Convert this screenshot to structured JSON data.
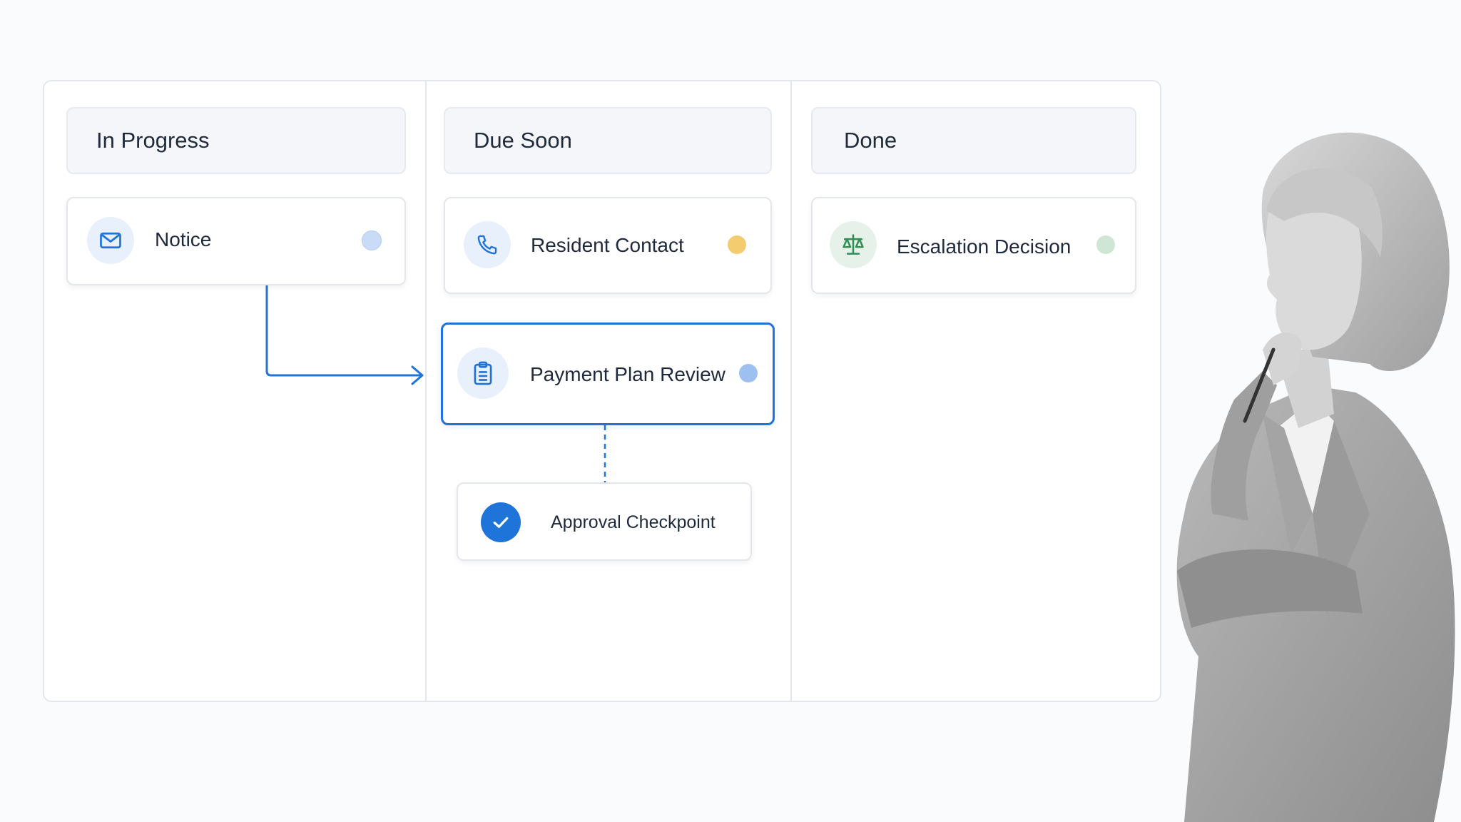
{
  "columns": [
    {
      "title": "In Progress"
    },
    {
      "title": "Due Soon"
    },
    {
      "title": "Done"
    }
  ],
  "cards": {
    "notice": {
      "label": "Notice",
      "icon": "mail-icon",
      "status_color": "#c9dcf7"
    },
    "resident_contact": {
      "label": "Resident Contact",
      "icon": "phone-icon",
      "status_color": "#f2cc6e"
    },
    "payment_plan_review": {
      "label": "Payment Plan Review",
      "icon": "clipboard-icon",
      "status_color": "#9dc0f1"
    },
    "approval_checkpoint": {
      "label": "Approval Checkpoint",
      "icon": "check-circle-icon"
    },
    "escalation_decision": {
      "label": "Escalation Decision",
      "icon": "scales-icon",
      "status_color": "#cfe6d5"
    }
  },
  "colors": {
    "accent": "#1f74d9",
    "icon_bg_blue": "#e8f0fb",
    "icon_bg_green": "#e6f2e9",
    "icon_green": "#2f8f54"
  }
}
